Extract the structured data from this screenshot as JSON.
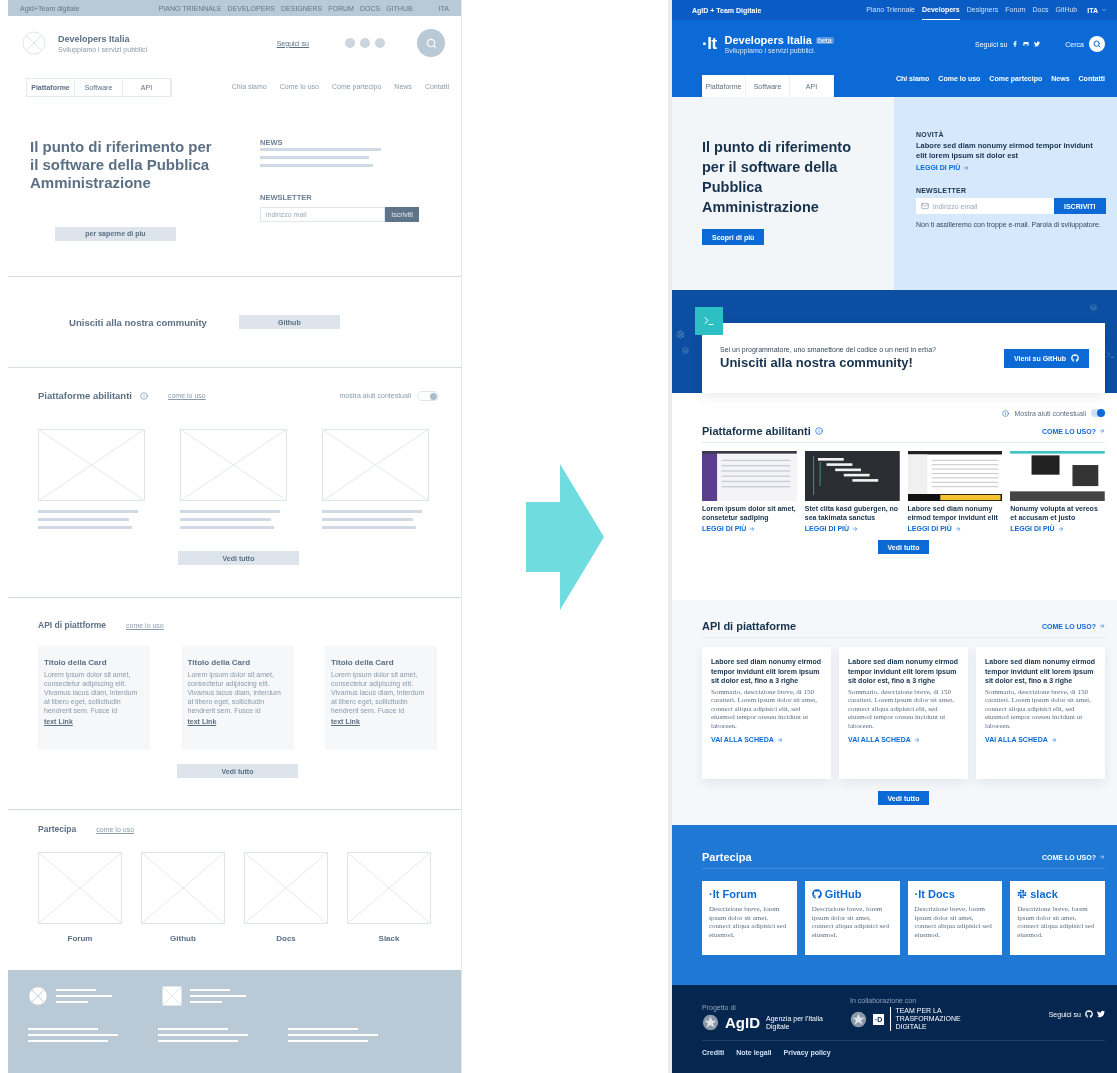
{
  "wireframe": {
    "top_bar": {
      "brand": "Agid+Team digitale",
      "links": [
        "PIANO TRIENNALE",
        "DEVELOPERS",
        "DESIGNERS",
        "FORUM",
        "DOCS",
        "GITHUB"
      ],
      "language": "ITA"
    },
    "header": {
      "title": "Developers Italia",
      "subtitle": "Sviluppiamo i servizi pubblici",
      "follow": "Seguici su"
    },
    "tabs": [
      {
        "label": "Piattaforme",
        "selected": true
      },
      {
        "label": "Software",
        "selected": false
      },
      {
        "label": "API",
        "selected": false
      }
    ],
    "nav": [
      "Chia siamo",
      "Come lo uso",
      "Come partecipo",
      "News",
      "Contatti"
    ],
    "hero": {
      "title": "Il punto di riferimento per il software della Pubblica Amministrazione",
      "button": "per saperne di piu",
      "news_label": "NEWS",
      "newsletter_label": "NEWSLETTER",
      "email_placeholder": "indirizzo mail",
      "subscribe": "Iscriviti"
    },
    "community": {
      "title": "Unisciti alla nostra community",
      "button": "Github"
    },
    "platforms": {
      "title": "Piattaforme abilitanti",
      "link": "come lo uso",
      "toggle_label": "mostra aiuti contestuali",
      "toggle_on": true,
      "button": "Vedi tutto"
    },
    "apis": {
      "title": "API di piattforme",
      "link": "come lo uso",
      "button": "Vedi tutto",
      "cards": [
        {
          "title": "Titolo della Card",
          "text": "Lorem ipsum dolor sit amet, consectetur adipiscing elit. Vivamus lacus diam, interdum at libero eget, sollicitudin hendrerit sem. Fusce id",
          "link": "text Link"
        },
        {
          "title": "Titolo della Card",
          "text": "Lorem ipsum dolor sit amet, consectetur adipiscing elit. Vivamus lacus diam, interdum at libero eget, sollicitudin hendrerit sem. Fusce id",
          "link": "text Link"
        },
        {
          "title": "Titolo della Card",
          "text": "Lorem ipsum dolor sit amet, consectetur adipiscing elit. Vivamus lacus diam, interdum at libero eget, sollicitudin hendrerit sem. Fusce id",
          "link": "text Link"
        }
      ]
    },
    "participate": {
      "title": "Partecipa",
      "link": "come lo uso",
      "items": [
        "Forum",
        "Github",
        "Docs",
        "Slack"
      ]
    }
  },
  "design": {
    "top_bar": {
      "brand": "AgID + Team Digitale",
      "links": [
        {
          "label": "Piano Triennale",
          "selected": false
        },
        {
          "label": "Developers",
          "selected": true
        },
        {
          "label": "Designers",
          "selected": false
        },
        {
          "label": "Forum",
          "selected": false
        },
        {
          "label": "Docs",
          "selected": false
        },
        {
          "label": "GitHub",
          "selected": false
        }
      ],
      "language": "ITA"
    },
    "header": {
      "logo": "·It",
      "title": "Developers Italia",
      "badge": "beta",
      "subtitle": "Sviluppiamo i servizi pubblici.",
      "follow": "Seguici su",
      "search": "Cerca"
    },
    "tabs": [
      "Piattaforme",
      "Software",
      "API"
    ],
    "nav": [
      "Chi siamo",
      "Come lo uso",
      "Come partecipo",
      "News",
      "Contatti"
    ],
    "hero": {
      "title": "Il punto di riferimento per il software della Pubblica Amministrazione",
      "button": "Scopri di più",
      "news_label": "NOVITÀ",
      "news_title": "Labore sed diam nonumy eirmod tempor invidunt elit lorem ipsum sit dolor est",
      "read_more": "LEGGI DI PIÙ",
      "newsletter_label": "NEWSLETTER",
      "email_placeholder": "indirizzo email",
      "subscribe": "ISCRIVITI",
      "note": "Non ti assilleremo con troppe e-mail. Parola di sviluppatore."
    },
    "community": {
      "intro": "Sei un programmatore, uno smanettone del codice o un nerd in erba?",
      "title": "Unisciti alla nostra community!",
      "button": "Vieni su GitHub"
    },
    "platforms": {
      "toggle_label": "Mostra aiuti contestuali",
      "toggle_on": true,
      "title": "Piattaforme abilitanti",
      "link": "COME LO USO?",
      "button": "Vedi tutto",
      "cards": [
        {
          "kind": "sidebar",
          "title": "Lorem ipsum dolor sit amet, consetetur sadiping",
          "link": "LEGGI DI PIÙ"
        },
        {
          "kind": "gantt",
          "title": "Stet clita kasd gubergen, no sea takimata sanctus",
          "link": "LEGGI DI PIÙ"
        },
        {
          "kind": "table",
          "title": "Labore sed diam nonumy eirmod tempor invidunt elit",
          "link": "LEGGI DI PIÙ"
        },
        {
          "kind": "calendar",
          "title": "Nonumy volupta at vereos et accusam et justo",
          "link": "LEGGI DI PIÙ"
        }
      ]
    },
    "apis": {
      "title": "API di piattaforme",
      "link": "COME LO USO?",
      "button": "Vedi tutto",
      "cards": [
        {
          "title": "Labore sed diam nonumy eirmod tempor invidunt elit lorem ipsum sit dolor est, fino a 3 righe",
          "text": "Sommario, descrizione breve, di 150 caratteri. Lorem ipsum dolor sit amet, connect aliqua adipisici elit, sed eiusmod tempor oreseu incidunt ut laboreen.",
          "link": "VAI ALLA SCHEDA"
        },
        {
          "title": "Labore sed diam nonumy eirmod tempor invidunt elit lorem ipsum sit dolor est, fino a 3 righe",
          "text": "Sommario, descrizione breve, di 150 caratteri. Lorem ipsum dolor sit amet, connect aliqua adipisici elit, sed eiusmod tempor oreseu incidunt ut laboreen.",
          "link": "VAI ALLA SCHEDA"
        },
        {
          "title": "Labore sed diam nonumy eirmod tempor invidunt elit lorem ipsum sit dolor est, fino a 3 righe",
          "text": "Sommario, descrizione breve, di 150 caratteri. Lorem ipsum dolor sit amet, connect aliqua adipisici elit, sed eiusmod tempor oreseu incidunt ut laboreen.",
          "link": "VAI ALLA SCHEDA"
        }
      ]
    },
    "participate": {
      "title": "Partecipa",
      "link": "COME LO USO?",
      "cards": [
        {
          "kind": "it",
          "prefix": "·It",
          "name": "Forum",
          "text": "Descrizione breve, lorem ipsum dolor sit amet, connect aliqua adipisici sed eiusmod."
        },
        {
          "kind": "github",
          "name": "GitHub",
          "text": "Descrizione breve, lorem ipsum dolor sit amet, connect aliqua adipisici sed eiusmod."
        },
        {
          "kind": "it",
          "prefix": "·It",
          "name": "Docs",
          "text": "Descrizione breve, lorem ipsum dolor sit amet, connect aliqua adipisici sed eiusmod."
        },
        {
          "kind": "slack",
          "name": "slack",
          "text": "Descrizione breve, lorem ipsum dolor sit amet, connect aliqua adipisici sed eiusmod."
        }
      ]
    },
    "footer": {
      "project_label": "Progetto di",
      "agid": "AgID",
      "agid_name": "Agenzia per l'Italia Digitale",
      "collab_label": "In collaborazione con",
      "team_logo": "·D",
      "team": "TEAM PER LA TRASFORMAZIONE DIGITALE",
      "follow": "Seguici su",
      "links": [
        "Crediti",
        "Note legali",
        "Privacy policy"
      ]
    }
  }
}
